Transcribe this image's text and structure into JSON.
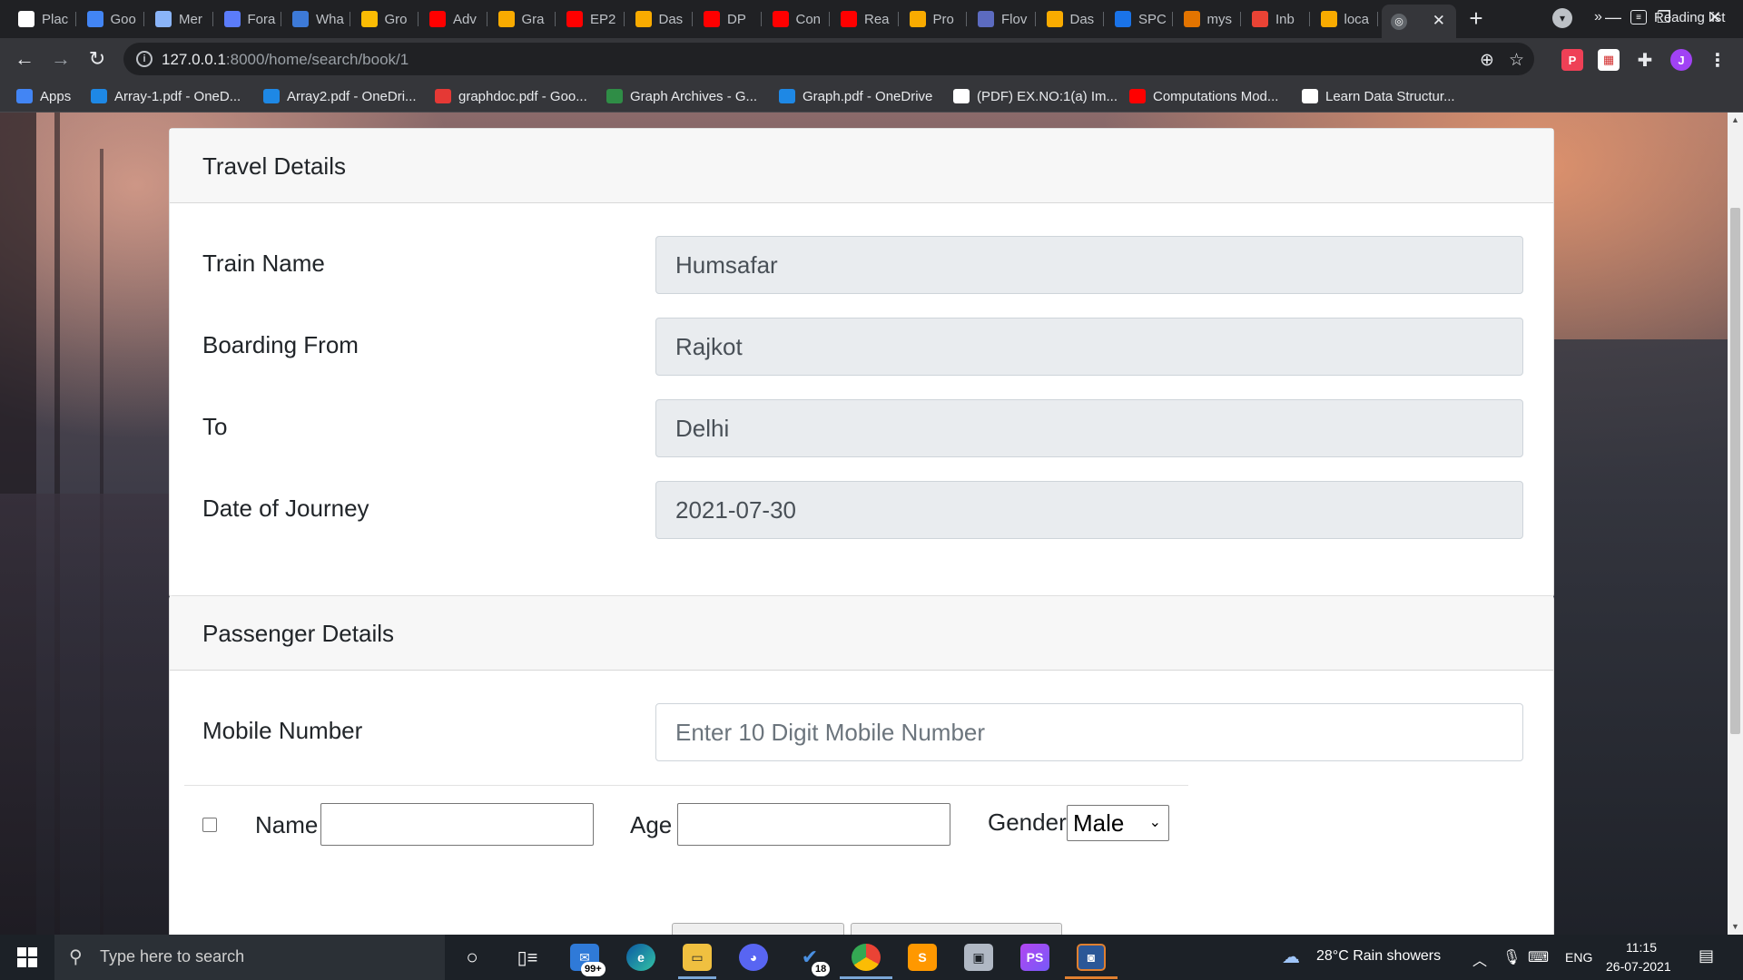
{
  "browser": {
    "tabs": [
      {
        "label": "Plac",
        "icon": "github-icon",
        "color": "#ffffff"
      },
      {
        "label": "Goo",
        "icon": "google-drive-icon",
        "color": "#4285f4"
      },
      {
        "label": "Mer",
        "icon": "mountain-icon",
        "color": "#8ab4f8"
      },
      {
        "label": "Fora",
        "icon": "diamond-icon",
        "color": "#5b7cfa"
      },
      {
        "label": "Wha",
        "icon": "video-icon",
        "color": "#3d7ad8"
      },
      {
        "label": "Gro",
        "icon": "google-drive-icon",
        "color": "#fbbc04"
      },
      {
        "label": "Adv",
        "icon": "youtube-icon",
        "color": "#ff0000"
      },
      {
        "label": "Gra",
        "icon": "bar-chart-icon",
        "color": "#f9ab00"
      },
      {
        "label": "EP2",
        "icon": "youtube-icon",
        "color": "#ff0000"
      },
      {
        "label": "Das",
        "icon": "bar-chart-icon",
        "color": "#f9ab00"
      },
      {
        "label": "DP",
        "icon": "youtube-icon",
        "color": "#ff0000"
      },
      {
        "label": "Con",
        "icon": "youtube-icon",
        "color": "#ff0000"
      },
      {
        "label": "Rea",
        "icon": "youtube-icon",
        "color": "#ff0000"
      },
      {
        "label": "Pro",
        "icon": "bar-chart-icon",
        "color": "#f9ab00"
      },
      {
        "label": "Flov",
        "icon": "cube-icon",
        "color": "#5c6bc0"
      },
      {
        "label": "Das",
        "icon": "bar-chart-icon",
        "color": "#f9ab00"
      },
      {
        "label": "SPC",
        "icon": "s-icon",
        "color": "#1a73e8"
      },
      {
        "label": "mys",
        "icon": "flame-icon",
        "color": "#e37400"
      },
      {
        "label": "Inb",
        "icon": "gmail-icon",
        "color": "#ea4335"
      },
      {
        "label": "loca",
        "icon": "warning-icon",
        "color": "#f9ab00"
      }
    ],
    "active_tab_icon": "globe-icon",
    "url_host": "127.0.0.1",
    "url_path": ":8000/home/search/book/1",
    "bookmarks": [
      {
        "label": "Apps",
        "icon": "apps-grid-icon",
        "color": "#4285f4"
      },
      {
        "label": "Array-1.pdf - OneD...",
        "icon": "onedrive-icon",
        "color": "#1e88e5"
      },
      {
        "label": "Array2.pdf - OneDri...",
        "icon": "onedrive-icon",
        "color": "#1e88e5"
      },
      {
        "label": "graphdoc.pdf - Goo...",
        "icon": "pdf-icon",
        "color": "#e53935"
      },
      {
        "label": "Graph Archives - G...",
        "icon": "gfg-icon",
        "color": "#2f8d46"
      },
      {
        "label": "Graph.pdf - OneDrive",
        "icon": "onedrive-icon",
        "color": "#1e88e5"
      },
      {
        "label": "(PDF) EX.NO:1(a) Im...",
        "icon": "academia-icon",
        "color": "#ffffff"
      },
      {
        "label": "Computations Mod...",
        "icon": "youtube-icon",
        "color": "#ff0000"
      },
      {
        "label": "Learn Data Structur...",
        "icon": "cc-icon",
        "color": "#ffffff"
      }
    ],
    "more_bookmarks": "»",
    "reading_list": "Reading list",
    "profile_initial": "J"
  },
  "travel": {
    "header": "Travel Details",
    "fields": [
      {
        "label": "Train Name",
        "value": "Humsafar"
      },
      {
        "label": "Boarding From",
        "value": "Rajkot"
      },
      {
        "label": "To",
        "value": "Delhi"
      },
      {
        "label": "Date of Journey",
        "value": "2021-07-30"
      }
    ]
  },
  "passenger": {
    "header": "Passenger Details",
    "mobile_label": "Mobile Number",
    "mobile_placeholder": "Enter 10 Digit Mobile Number",
    "mobile_value": "",
    "name_label": "Name",
    "age_label": "Age",
    "gender_label": "Gender",
    "gender_value": "Male"
  },
  "taskbar": {
    "search_placeholder": "Type here to search",
    "mail_badge": "99+",
    "todo_badge": "18",
    "weather": "28°C  Rain showers",
    "language": "ENG",
    "time": "11:15",
    "date": "26-07-2021"
  }
}
